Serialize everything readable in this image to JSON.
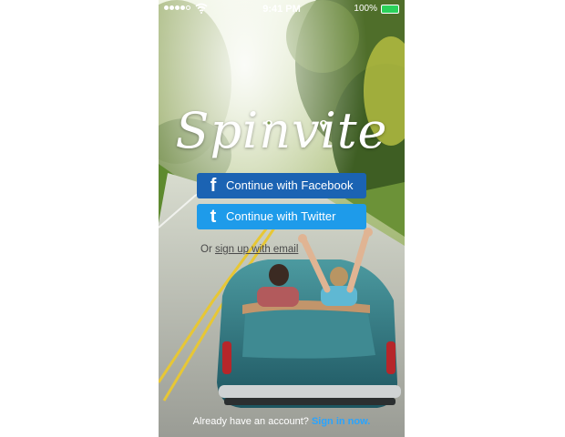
{
  "status_bar": {
    "time": "9:41 PM",
    "battery_percent": "100%",
    "signal_bars_filled": 4,
    "signal_bars_total": 5
  },
  "brand": {
    "logo_text": "Spinvite"
  },
  "auth": {
    "facebook_label": "Continue with Facebook",
    "twitter_label": "Continue with Twitter",
    "signup_prefix": "Or",
    "signup_link": "sign up with email",
    "signin_prefix": "Already have an account?",
    "signin_link": "Sign in now."
  },
  "icons": {
    "facebook": "facebook-icon",
    "twitter": "twitter-icon",
    "wifi": "wifi-icon",
    "battery": "battery-icon",
    "pin": "map-pin-icon"
  },
  "colors": {
    "facebook_button": "#1b63b3",
    "twitter_button": "#1e9bea",
    "signin_link": "#29a4ff",
    "battery_fill": "#2ad15a"
  }
}
